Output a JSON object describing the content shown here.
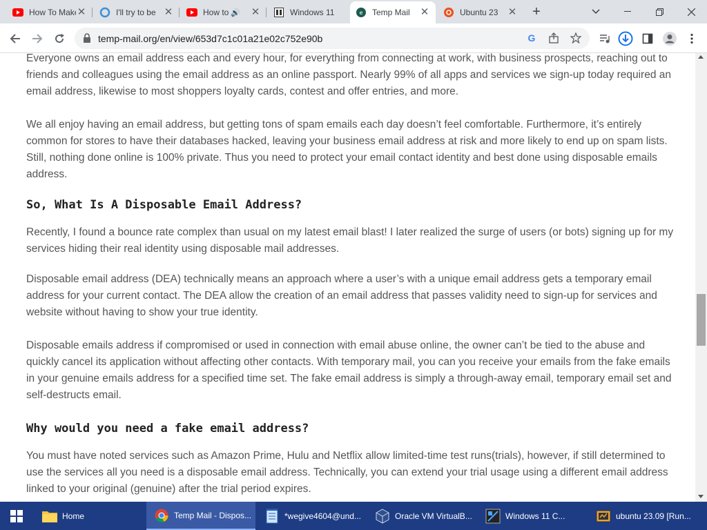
{
  "tabs": [
    {
      "title": "How To Make",
      "icon": "youtube-icon"
    },
    {
      "title": "I'll try to be",
      "icon": "ring-icon"
    },
    {
      "title": "How to",
      "icon": "youtube-icon"
    },
    {
      "title": "Windows 11",
      "icon": "windows-icon"
    },
    {
      "title": "Temp Mail",
      "icon": "temp-mail-icon"
    },
    {
      "title": "Ubuntu 23",
      "icon": "ubuntu-icon"
    }
  ],
  "address_bar": {
    "url": "temp-mail.org/en/view/653d7c1c01a21e02c752e90b"
  },
  "article": {
    "p1": "Everyone owns an email address each and every hour, for everything from connecting at work, with business prospects, reaching out to friends and colleagues using the email address as an online passport. Nearly 99% of all apps and services we sign-up today required an email address, likewise to most shoppers loyalty cards, contest and offer entries, and more.",
    "p2": "We all enjoy having an email address, but getting tons of spam emails each day doesn’t feel comfortable. Furthermore, it’s entirely common for stores to have their databases hacked, leaving your business email address at risk and more likely to end up on spam lists. Still, nothing done online is 100% private. Thus you need to protect your email contact identity and best done using disposable emails address.",
    "h1": "So, What Is A Disposable Email Address?",
    "p3": "Recently, I found a bounce rate complex than usual on my latest email blast! I later realized the surge of users (or bots) signing up for my services hiding their real identity using disposable mail addresses.",
    "p4": "Disposable email address (DEA) technically means an approach where a user’s with a unique email address gets a temporary email address for your current contact. The DEA allow the creation of an email address that passes validity need to sign-up for services and website without having to show your true identity.",
    "p5": "Disposable emails address if compromised or used in connection with email abuse online, the owner can’t be tied to the abuse and quickly cancel its application without affecting other contacts. With temporary mail, you can you receive your emails from the fake emails in your genuine emails address for a specified time set. The fake email address is simply a through-away email, temporary email set and self-destructs email.",
    "h2": "Why would you need a fake email address?",
    "p6": "You must have noted services such as Amazon Prime, Hulu and Netflix allow limited-time test runs(trials), however, if still determined to use the services all you need is a disposable email address. Technically, you can extend your trial usage using a different email address linked to your original (genuine) after the trial period expires."
  },
  "taskbar": {
    "items": [
      {
        "label": "Home",
        "icon": "folder-icon"
      },
      {
        "label": "Temp Mail - Dispos...",
        "icon": "chrome-icon"
      },
      {
        "label": "*wegive4604@und...",
        "icon": "notepad-icon"
      },
      {
        "label": "Oracle VM VirtualB...",
        "icon": "virtualbox-icon"
      },
      {
        "label": "Windows 11 C...",
        "icon": "app-icon"
      },
      {
        "label": "ubuntu 23.09 [Run...",
        "icon": "vm-icon"
      }
    ]
  },
  "colors": {
    "taskbar": "#1d3c83",
    "tab_strip": "#dee1e6",
    "link_blue": "#1a73e8"
  }
}
